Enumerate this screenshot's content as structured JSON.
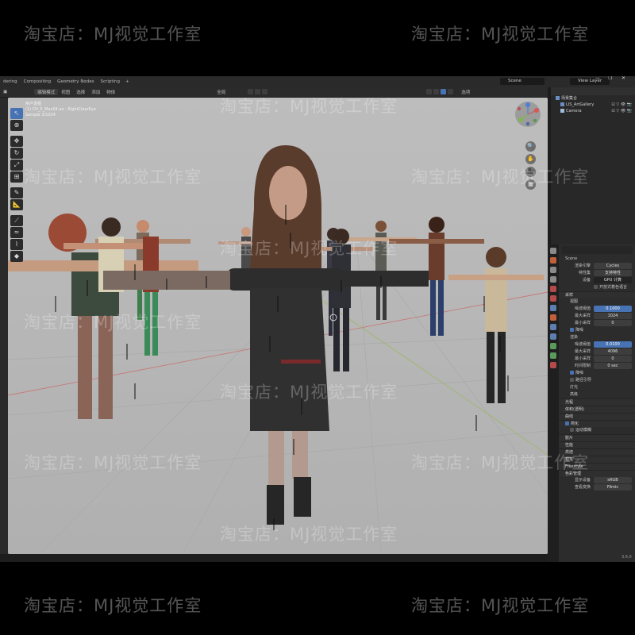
{
  "watermark": "淘宝店：MJ视觉工作室",
  "workspace_tabs": [
    "dering",
    "Compositing",
    "Geometry Nodes",
    "Scripting"
  ],
  "add_tab_glyph": "+",
  "scene_field": "Scene",
  "view_layer_field": "View Layer",
  "window_controls": [
    "—",
    "❐",
    "✕"
  ],
  "viewport_header": {
    "mode": "编辑模式",
    "menus": [
      "视图",
      "选择",
      "添加",
      "物体"
    ],
    "transform": "全局",
    "overlay_label": "选项"
  },
  "viewport_info": {
    "line1": "用户透视",
    "line2": "(1) CH_5_Max04.ao : RightClearEye",
    "line3": "Sample 3/1024"
  },
  "tools": [
    {
      "name": "select-tool",
      "glyph": "↖",
      "active": true
    },
    {
      "name": "cursor-tool",
      "glyph": "⊕"
    },
    {
      "name": "move-tool",
      "glyph": "✥"
    },
    {
      "name": "rotate-tool",
      "glyph": "↻"
    },
    {
      "name": "scale-tool",
      "glyph": "⤢"
    },
    {
      "name": "transform-tool",
      "glyph": "⊞"
    },
    {
      "name": "annotate-tool",
      "glyph": "✎"
    },
    {
      "name": "measure-tool",
      "glyph": "📐"
    },
    {
      "name": "pose-tool",
      "glyph": "⟋"
    },
    {
      "name": "relax-tool",
      "glyph": "≈"
    },
    {
      "name": "bone-tool",
      "glyph": "⌇"
    },
    {
      "name": "eraser-tool",
      "glyph": "◆"
    }
  ],
  "nav_buttons": [
    "🔍",
    "✋",
    "🎥",
    "▦"
  ],
  "outliner": {
    "header": "场景集合",
    "rows": [
      {
        "label": "场景集合",
        "child": false
      },
      {
        "label": "LIS_ArtGallery",
        "child": true,
        "icon": "collection"
      },
      {
        "label": "Camera",
        "child": true,
        "icon": "camera"
      }
    ],
    "vis_glyphs": "☑ ▽ 👁 📷"
  },
  "properties": {
    "object_label": "Scene",
    "render_engine_label": "渲染引擎",
    "render_engine": "Cycles",
    "feature_set_label": "特性集",
    "feature_set": "支持特性",
    "device_label": "设备",
    "device": "GPU 计算",
    "open_shading_label": "开放式着色语言",
    "sampling_section": "采样",
    "viewport_sub": "视图",
    "noise_threshold_label": "噪波阈值",
    "viewport_noise_threshold": "0.1000",
    "max_samples_label": "最大采样",
    "viewport_max_samples": "1024",
    "min_samples_label": "最小采样",
    "viewport_min_samples": "0",
    "denoise_label": "降噪",
    "render_sub": "渲染",
    "render_noise_threshold": "0.0100",
    "render_max_samples": "4096",
    "render_min_samples": "0",
    "time_limit_label": "时间限制",
    "time_limit": "0 sec",
    "denoise2_label": "降噪",
    "path_guiding_label": "路径引导",
    "lights_label": "灯光",
    "advanced_label": "高级",
    "sections": [
      "光程",
      "体积(透明)",
      "曲线",
      "简化",
      "运动模糊",
      "胶片",
      "性能",
      "烘焙",
      "蜡笔",
      "Freestyle",
      "色彩管理"
    ],
    "display_device_label": "显示设备",
    "display_device": "sRGB",
    "view_transform_label": "查看变换",
    "view_transform": "Filmic"
  },
  "version": "3.6.0"
}
